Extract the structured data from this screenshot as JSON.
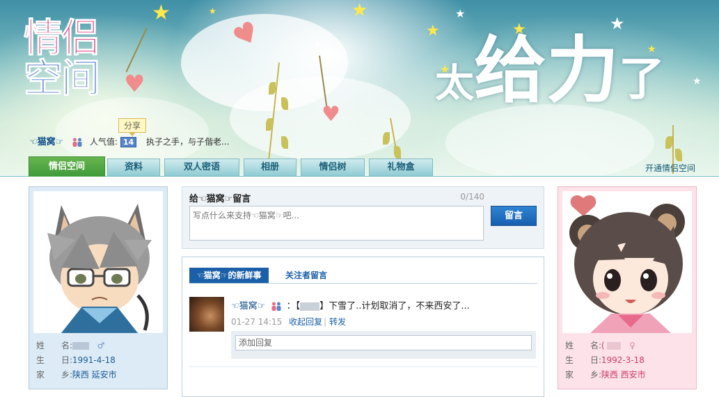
{
  "header": {
    "logo_line1": "情侣",
    "logo_line2": "空间",
    "slogan_1": "太",
    "slogan_2": "给力",
    "slogan_3": "了",
    "share_label": "分享",
    "nickname": "☜猫窝☞",
    "popularity_label": "人气值:",
    "popularity_value": "14",
    "quote": "执子之手，与子偕老..."
  },
  "nav": {
    "tabs": [
      "情侣空间",
      "资料",
      "双人密语",
      "相册",
      "情侣树",
      "礼物盒"
    ],
    "active_tab": "情侣空间",
    "open_link": "开通情侣空间"
  },
  "left_profile": {
    "name_label": "姓　　名:",
    "gender_symbol": "♂",
    "birthday_label": "生　　日:",
    "birthday": "1991-4-18",
    "hometown_label": "家　　乡:",
    "hometown": "陕西  延安市"
  },
  "right_profile": {
    "name_label": "姓　　名:",
    "name_visible": "(",
    "gender_symbol": "♀",
    "birthday_label": "生　　日:",
    "birthday": "1992-3-18",
    "hometown_label": "家　　乡:",
    "hometown": "陕西  西安市"
  },
  "message": {
    "title": "给☜猫窝☞留言",
    "counter": "0/140",
    "placeholder": "写点什么来支持☜猫窝☞吧...",
    "submit_label": "留言"
  },
  "feed": {
    "tabs": [
      "☜猫窝☞的新鲜事",
      "关注者留言"
    ],
    "post": {
      "author": "☜猫窝☞",
      "text_prefix": "：【",
      "text_suffix": "】下雪了..计划取消了，不来西安了...",
      "timestamp": "01-27 14:15",
      "action_reply": "收起回复",
      "action_forward": "转发",
      "reply_placeholder": "添加回复"
    }
  },
  "colors": {
    "brand_blue": "#1a5fa8",
    "nav_active": "#3f9a3a",
    "male_value": "#1d5d97",
    "female_value": "#cc3b6a"
  }
}
